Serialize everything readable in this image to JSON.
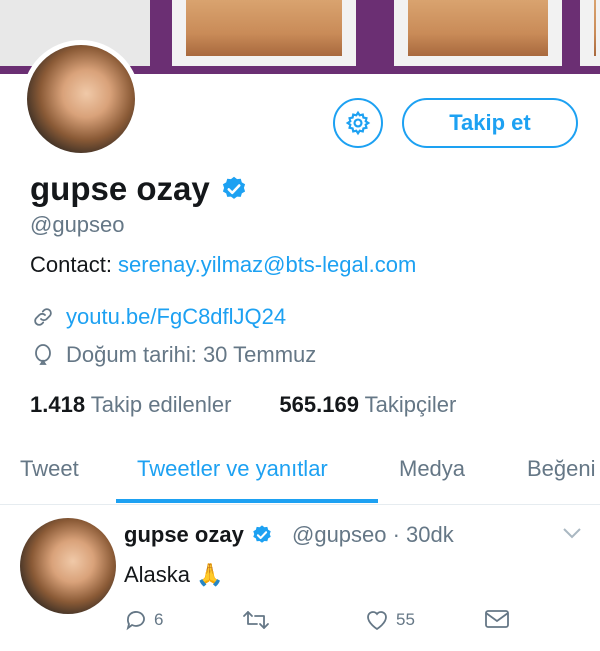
{
  "profile": {
    "name": "gupse ozay",
    "handle": "@gupseo",
    "bio_prefix": "Contact: ",
    "bio_email": "serenay.yilmaz@bts-legal.com",
    "link": "youtu.be/FgC8dflJQ24",
    "birthday": "Doğum tarihi: 30 Temmuz",
    "follow_label": "Takip et"
  },
  "stats": {
    "following_count": "1.418",
    "following_label": "Takip edilenler",
    "followers_count": "565.169",
    "followers_label": "Takipçiler"
  },
  "tabs": [
    {
      "label": "Tweet"
    },
    {
      "label": "Tweetler ve yanıtlar"
    },
    {
      "label": "Medya"
    },
    {
      "label": "Beğeni"
    }
  ],
  "tweet": {
    "name": "gupse ozay",
    "meta": "@gupseo · 30dk",
    "text": "Alaska 🙏",
    "reply_count": "6",
    "retweet_count": "",
    "like_count": "55"
  },
  "colors": {
    "accent": "#1da1f2",
    "muted": "#657786",
    "banner": "#6b2f73"
  }
}
